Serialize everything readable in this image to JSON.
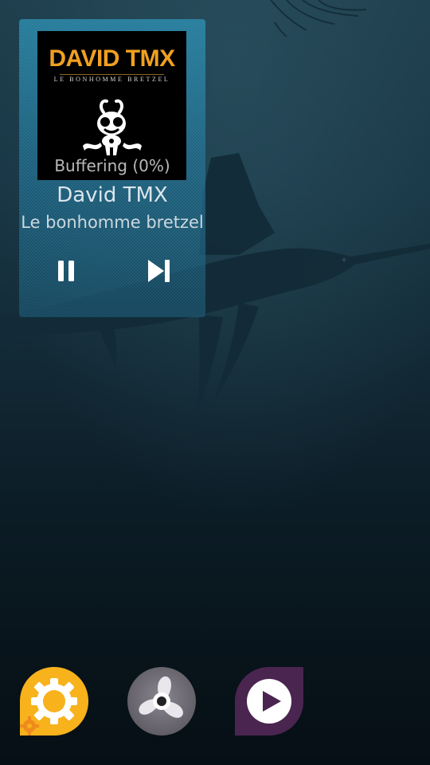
{
  "player": {
    "album_art": {
      "title": "DAVID TMX",
      "subtitle": "LE BONHOMME BRETZEL",
      "title_color": "#f0a020"
    },
    "status": "Buffering (0%)",
    "artist": "David TMX",
    "album": "Le bonhomme bretzel",
    "progress_percent": 0,
    "controls": {
      "pause_icon": "pause-icon",
      "next_icon": "skip-next-icon"
    },
    "accent_color": "#2a8fb5"
  },
  "dock": {
    "apps": [
      {
        "icon": "settings-gear-icon",
        "color": "#f7b21c"
      },
      {
        "icon": "propeller-fan-icon",
        "color": "#6e6b73"
      },
      {
        "icon": "media-play-icon",
        "color": "#4a2550"
      }
    ]
  }
}
